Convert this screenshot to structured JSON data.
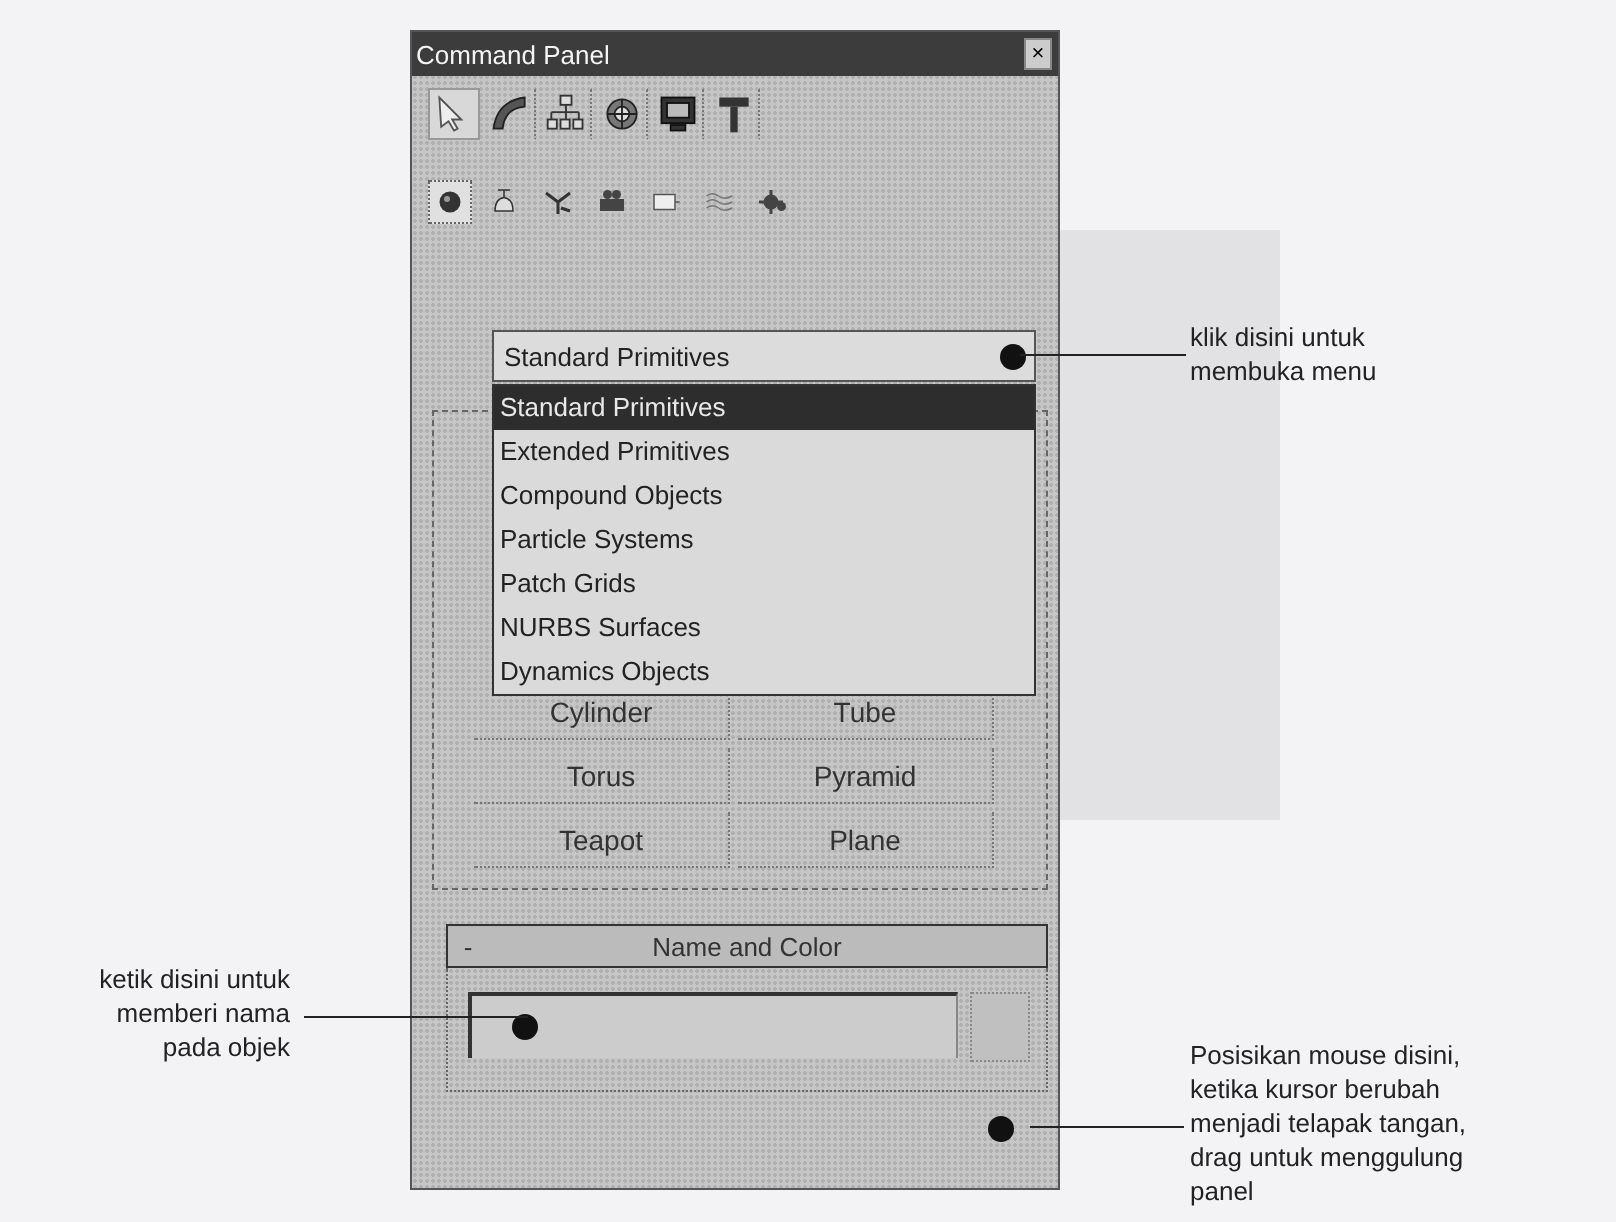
{
  "window": {
    "title": "Command Panel",
    "close": "×"
  },
  "tabs": [
    {
      "selected": true
    },
    {
      "selected": false
    },
    {
      "selected": false
    },
    {
      "selected": false
    },
    {
      "selected": false
    },
    {
      "selected": false
    }
  ],
  "categories": [
    {
      "selected": true
    },
    {
      "selected": false
    },
    {
      "selected": false
    },
    {
      "selected": false
    },
    {
      "selected": false
    },
    {
      "selected": false
    },
    {
      "selected": false
    }
  ],
  "dropdown": {
    "value": "Standard Primitives",
    "options": [
      {
        "label": "Standard Primitives",
        "selected": true
      },
      {
        "label": "Extended Primitives",
        "selected": false
      },
      {
        "label": "Compound Objects",
        "selected": false
      },
      {
        "label": "Particle Systems",
        "selected": false
      },
      {
        "label": "Patch Grids",
        "selected": false
      },
      {
        "label": "NURBS Surfaces",
        "selected": false
      },
      {
        "label": "Dynamics Objects",
        "selected": false
      }
    ]
  },
  "object_buttons": [
    "Cylinder",
    "Tube",
    "Torus",
    "Pyramid",
    "Teapot",
    "Plane"
  ],
  "name_rollout": {
    "collapse": "-",
    "title": "Name and Color"
  },
  "annotations": [
    {
      "kind": "menu",
      "text": "klik disini untuk\nmembuka menu"
    },
    {
      "kind": "name",
      "text": "ketik disini untuk\nmemberi nama\npada objek"
    },
    {
      "kind": "scroll",
      "text": "Posisikan mouse disini,\nketika kursor berubah\nmenjadi telapak tangan,\ndrag untuk menggulung\npanel"
    }
  ]
}
